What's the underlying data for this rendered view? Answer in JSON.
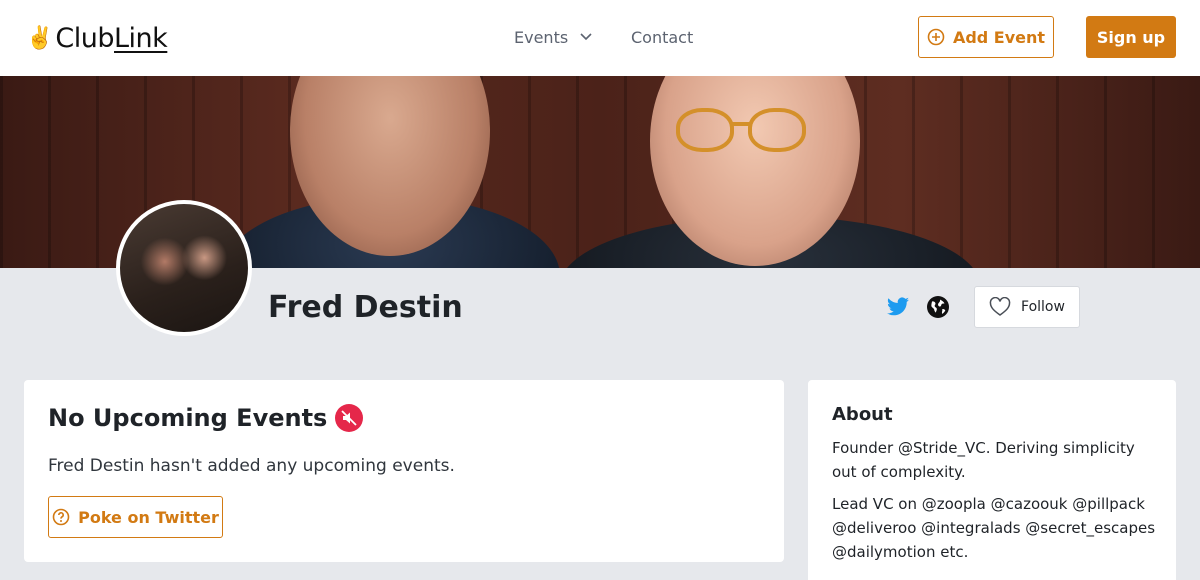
{
  "header": {
    "logo": {
      "emoji": "✌️",
      "club": "Club",
      "link": "Link"
    },
    "nav": {
      "events_label": "Events",
      "contact_label": "Contact"
    },
    "add_event_label": "Add Event",
    "signup_label": "Sign up"
  },
  "profile": {
    "name": "Fred Destin",
    "follow_label": "Follow"
  },
  "events": {
    "title": "No Upcoming Events",
    "message": "Fred Destin hasn't added any upcoming events.",
    "poke_label": "Poke on Twitter"
  },
  "about": {
    "title": "About",
    "bio": [
      "Founder @Stride_VC. Deriving simplicity out of complexity.",
      "Lead VC on @zoopla @cazoouk @pillpack @deliveroo @integralads @secret_escapes @dailymotion etc."
    ]
  },
  "colors": {
    "accent": "#d27a13",
    "twitter": "#1d9bf0",
    "background": "#e6e8ec"
  },
  "icons": {
    "events_chevron": "chevron-down-icon",
    "add_event": "plus-circle-icon",
    "twitter": "twitter-icon",
    "website": "globe-icon",
    "follow": "heart-icon",
    "no_events": "muted-speaker-icon",
    "poke": "question-circle-icon"
  }
}
